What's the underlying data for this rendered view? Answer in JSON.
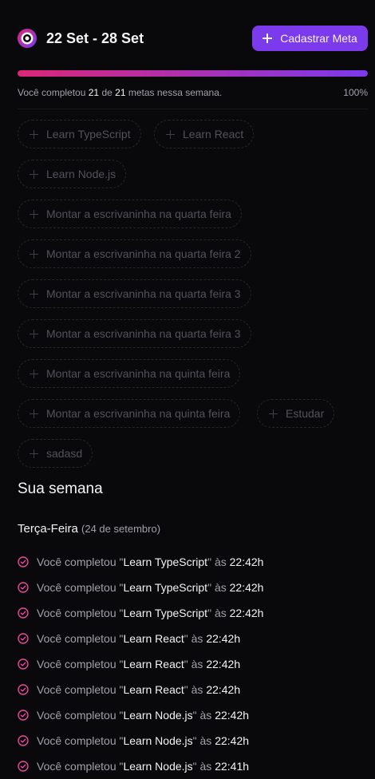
{
  "header": {
    "week_range": "22 Set - 28 Set",
    "add_button_label": "Cadastrar Meta",
    "accent_color": "#7c3aed"
  },
  "progress": {
    "percent": 100,
    "prefix": "Você completou",
    "completed": "21",
    "connector": "de",
    "total": "21",
    "suffix": "metas nessa semana.",
    "percent_label": "100%",
    "gradient": [
      "#db2777",
      "#7c3aed"
    ]
  },
  "pending_goals": [
    {
      "label": "Learn TypeScript"
    },
    {
      "label": "Learn React"
    },
    {
      "label": "Learn Node.js"
    },
    {
      "label": "Montar a escrivaninha na quarta feira"
    },
    {
      "label": "Montar a escrivaninha na quarta feira 2"
    },
    {
      "label": "Montar a escrivaninha na quarta feira 3"
    },
    {
      "label": "Montar a escrivaninha na quarta feira 3"
    },
    {
      "label": "Montar a escrivaninha na quinta feira"
    },
    {
      "label": "Montar a escrivaninha na quinta feira"
    },
    {
      "label": "Estudar"
    },
    {
      "label": "sadasd"
    }
  ],
  "summary": {
    "title": "Sua semana",
    "day": {
      "name": "Terça-Feira",
      "date": "(24 de setembro)",
      "entries": [
        {
          "prefix": "Você completou \"",
          "goal": "Learn TypeScript",
          "mid": "\" às ",
          "time": "22:42h"
        },
        {
          "prefix": "Você completou \"",
          "goal": "Learn TypeScript",
          "mid": "\" às ",
          "time": "22:42h"
        },
        {
          "prefix": "Você completou \"",
          "goal": "Learn TypeScript",
          "mid": "\" às ",
          "time": "22:42h"
        },
        {
          "prefix": "Você completou \"",
          "goal": "Learn React",
          "mid": "\" às ",
          "time": "22:42h"
        },
        {
          "prefix": "Você completou \"",
          "goal": "Learn React",
          "mid": "\" às ",
          "time": "22:42h"
        },
        {
          "prefix": "Você completou \"",
          "goal": "Learn React",
          "mid": "\" às ",
          "time": "22:42h"
        },
        {
          "prefix": "Você completou \"",
          "goal": "Learn Node.js",
          "mid": "\" às ",
          "time": "22:42h"
        },
        {
          "prefix": "Você completou \"",
          "goal": "Learn Node.js",
          "mid": "\" às ",
          "time": "22:42h"
        },
        {
          "prefix": "Você completou \"",
          "goal": "Learn Node.js",
          "mid": "\" às ",
          "time": "22:41h"
        }
      ]
    }
  },
  "icons": {
    "logo": "in-orbit-logo-icon",
    "add": "plus-icon",
    "entry": "check-circle-icon"
  }
}
